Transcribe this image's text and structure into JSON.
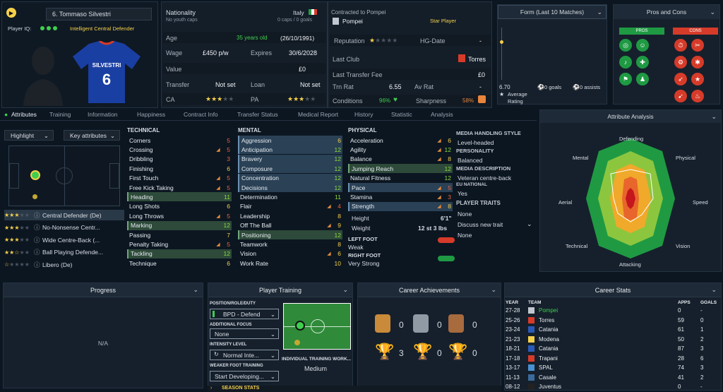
{
  "player": {
    "number_name": "6. Tommaso Silvestri",
    "iq_label": "Player IQ:",
    "role_tag": "Intelligent Central Defender",
    "shirt_name": "SILVESTRI",
    "shirt_number": "6"
  },
  "info": {
    "nationality_label": "Nationality",
    "nationality_sub": "No youth caps",
    "nation": "Italy",
    "caps": "0 caps / 0 goals",
    "contracted_label": "Contracted to Pompei",
    "club": "Pompei",
    "status": "Star Player",
    "age_label": "Age",
    "age_value": "35 years old",
    "dob": "(26/10/1991)",
    "wage_label": "Wage",
    "wage": "£450 p/w",
    "expires_label": "Expires",
    "expires": "30/6/2028",
    "value_label": "Value",
    "value": "£0",
    "transfer_label": "Transfer",
    "transfer": "Not set",
    "loan_label": "Loan",
    "loan": "Not set",
    "ca_label": "CA",
    "pa_label": "PA",
    "rep_label": "Reputation",
    "hg_label": "HG-Date",
    "hg_value": "-",
    "last_club_label": "Last Club",
    "last_club": "Torres",
    "last_fee_label": "Last Transfer Fee",
    "last_fee": "£0",
    "trn_label": "Trn Rat",
    "trn": "6.55",
    "av_label": "Av Rat",
    "av": "-",
    "cond_label": "Conditions",
    "cond": "96%",
    "sharp_label": "Sharpness",
    "sharp": "58%"
  },
  "form": {
    "title": "Form (Last 10 Matches)",
    "rating": "6.70",
    "rating_label": "Average Rating",
    "goals": "0 goals",
    "assists": "0 assists"
  },
  "pros_cons": {
    "title": "Pros and Cons",
    "pros": "PROS",
    "cons": "CONS"
  },
  "tabs": [
    "Attributes",
    "Training",
    "Information",
    "Happiness",
    "Contract Info",
    "Transfer Status",
    "Medical Report",
    "History",
    "Statistic",
    "Analysis"
  ],
  "controls": {
    "highlight": "Highlight",
    "key": "Key attributes"
  },
  "roles": [
    {
      "name": "Central Defender (De)",
      "stars": 3
    },
    {
      "name": "No-Nonsense Centr...",
      "stars": 3
    },
    {
      "name": "Wide Centre-Back (...",
      "stars": 3
    },
    {
      "name": "Ball Playing Defende...",
      "stars": 2.5
    },
    {
      "name": "Libero (De)",
      "stars": 0.5
    }
  ],
  "technical": {
    "title": "TECHNICAL",
    "items": [
      [
        "Corners",
        "5"
      ],
      [
        "Crossing",
        "5"
      ],
      [
        "Dribbling",
        "3"
      ],
      [
        "Finishing",
        "6"
      ],
      [
        "First Touch",
        "5"
      ],
      [
        "Free Kick Taking",
        "5"
      ],
      [
        "Heading",
        "11"
      ],
      [
        "Long Shots",
        "6"
      ],
      [
        "Long Throws",
        "5"
      ],
      [
        "Marking",
        "12"
      ],
      [
        "Passing",
        "7"
      ],
      [
        "Penalty Taking",
        "5"
      ],
      [
        "Tackling",
        "12"
      ],
      [
        "Technique",
        "6"
      ]
    ]
  },
  "mental": {
    "title": "MENTAL",
    "items": [
      [
        "Aggression",
        "6"
      ],
      [
        "Anticipation",
        "12"
      ],
      [
        "Bravery",
        "12"
      ],
      [
        "Composure",
        "12"
      ],
      [
        "Concentration",
        "12"
      ],
      [
        "Decisions",
        "12"
      ],
      [
        "Determination",
        "11"
      ],
      [
        "Flair",
        "4"
      ],
      [
        "Leadership",
        "8"
      ],
      [
        "Off The Ball",
        "9"
      ],
      [
        "Positioning",
        "12"
      ],
      [
        "Teamwork",
        "8"
      ],
      [
        "Vision",
        "6"
      ],
      [
        "Work Rate",
        "10"
      ]
    ]
  },
  "physical": {
    "title": "PHYSICAL",
    "items": [
      [
        "Acceleration",
        "6"
      ],
      [
        "Agility",
        "12"
      ],
      [
        "Balance",
        "8"
      ],
      [
        "Jumping Reach",
        "12"
      ],
      [
        "Natural Fitness",
        "12"
      ],
      [
        "Pace",
        "5"
      ],
      [
        "Stamina",
        "3"
      ],
      [
        "Strength",
        "8"
      ]
    ],
    "height_label": "Height",
    "height": "6'1\"",
    "weight_label": "Weight",
    "weight": "12 st 3 lbs",
    "left_label": "LEFT FOOT",
    "left": "Weak",
    "right_label": "RIGHT FOOT",
    "right": "Very Strong"
  },
  "media": {
    "style_label": "MEDIA HANDLING STYLE",
    "style": "Level-headed",
    "pers_label": "PERSONALITY",
    "pers": "Balanced",
    "desc_label": "MEDIA DESCRIPTION",
    "desc": "Veteran centre-back",
    "eu_label": "EU NATIONAL",
    "eu": "Yes",
    "traits_label": "PLAYER TRAITS",
    "traits": "None",
    "discuss": "Discuss new trait",
    "discuss_val": "None"
  },
  "analysis": {
    "title": "Attribute Analysis",
    "labels": [
      "Defending",
      "Physical",
      "Speed",
      "Vision",
      "Attacking",
      "Technical",
      "Aerial",
      "Mental"
    ]
  },
  "progress": {
    "title": "Progress",
    "na": "N/A"
  },
  "training": {
    "title": "Player Training",
    "pos_label": "POSITION/ROLE/DUTY",
    "pos": "BPD - Defend",
    "focus_label": "ADDITIONAL FOCUS",
    "focus": "None",
    "int_label": "INTENSITY LEVEL",
    "int": "Normal Inte...",
    "weak_label": "WEAKER FOOT TRAINING",
    "weak": "Start Developing...",
    "ind_label": "INDIVIDUAL TRAINING WORK...",
    "ind": "Medium"
  },
  "achievements": {
    "title": "Career Achievements",
    "row1": [
      "0",
      "0",
      "0"
    ],
    "row2": [
      "3",
      "0",
      "0"
    ]
  },
  "career": {
    "title": "Career Stats",
    "headers": [
      "YEAR",
      "TEAM",
      "APPS",
      "GOALS"
    ],
    "rows": [
      [
        "27-28",
        "Pompei",
        "0",
        "-"
      ],
      [
        "25-26",
        "Torres",
        "59",
        "0"
      ],
      [
        "23-24",
        "Catania",
        "61",
        "1"
      ],
      [
        "21-23",
        "Modena",
        "50",
        "2"
      ],
      [
        "18-21",
        "Catania",
        "87",
        "3"
      ],
      [
        "17-18",
        "Trapani",
        "28",
        "6"
      ],
      [
        "13-17",
        "SPAL",
        "74",
        "3"
      ],
      [
        "11-13",
        "Casale",
        "41",
        "2"
      ],
      [
        "08-12",
        "Juventus",
        "0",
        "-"
      ]
    ]
  },
  "season": {
    "title": "SEASON STATS"
  },
  "colors": {
    "accent": "#f5d04a",
    "green": "#3ecf4e",
    "red": "#d63b2a"
  }
}
